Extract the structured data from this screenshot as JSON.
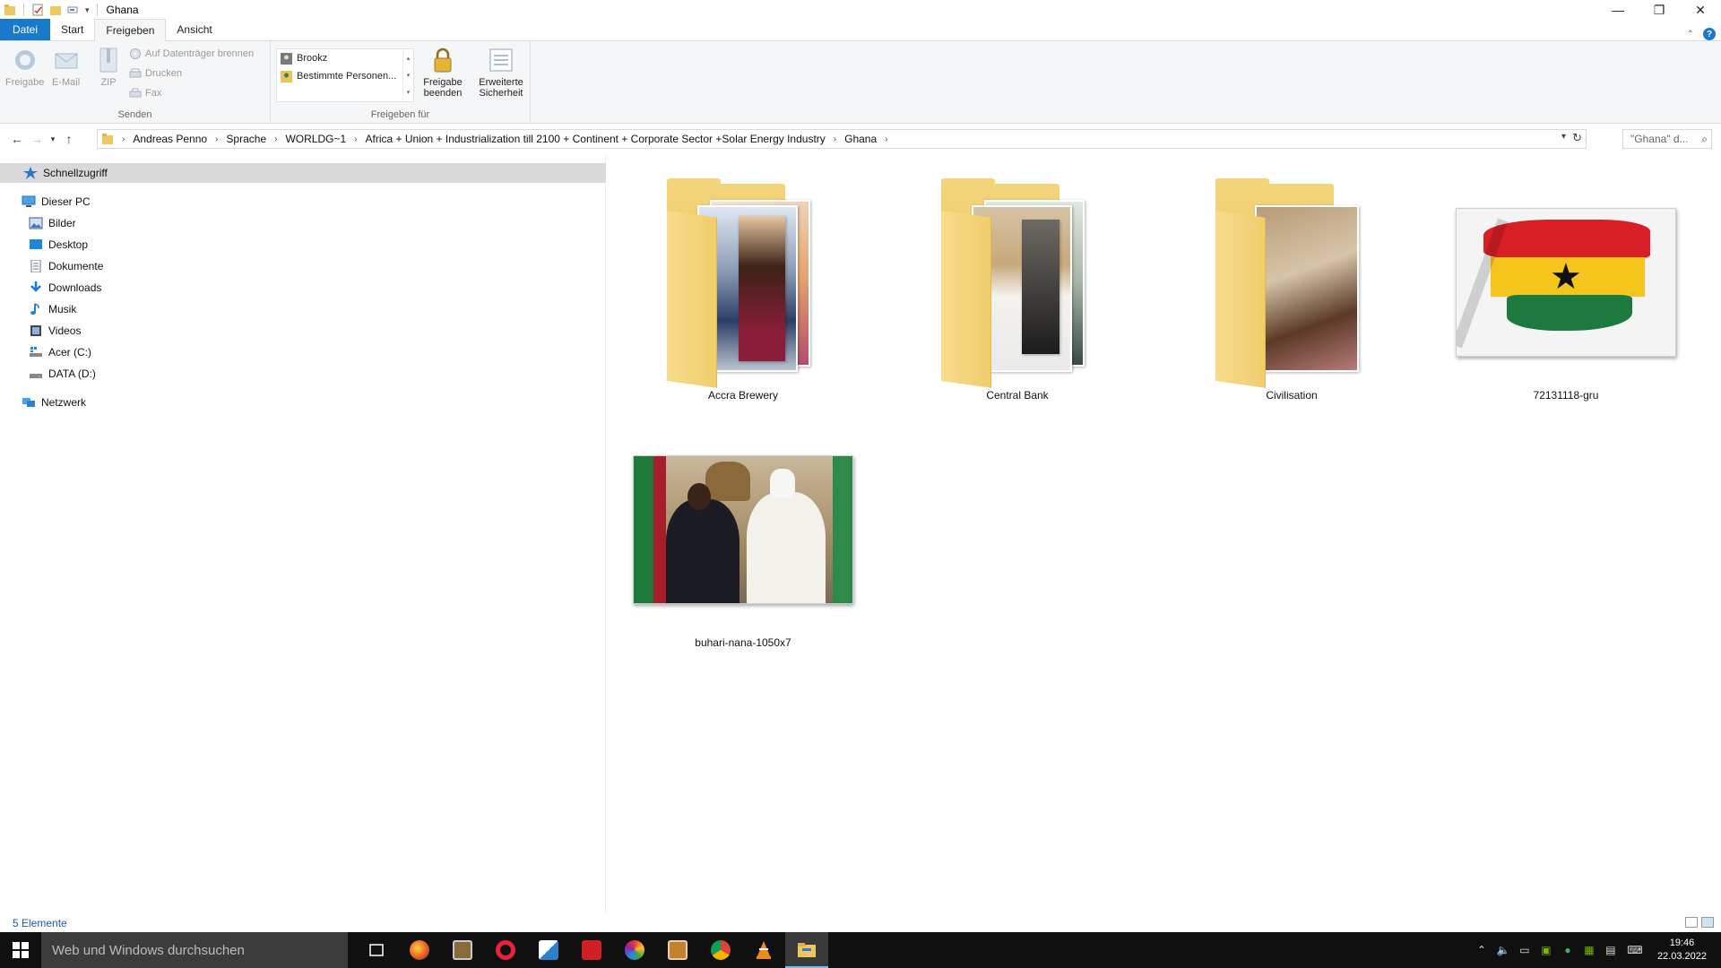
{
  "window": {
    "title": "Ghana",
    "minimize": "—",
    "restore": "❐",
    "close": "✕"
  },
  "ribbon_tabs": [
    "Datei",
    "Start",
    "Freigeben",
    "Ansicht"
  ],
  "ribbon": {
    "send_group": {
      "label": "Senden",
      "share": "Freigabe",
      "email": "E-Mail",
      "zip": "ZIP",
      "burn": "Auf Datenträger brennen",
      "print": "Drucken",
      "fax": "Fax"
    },
    "share_group": {
      "label": "Freigeben für",
      "items": [
        "Brookz",
        "Bestimmte Personen..."
      ],
      "stop_sharing": "Freigabe beenden",
      "advanced_security": "Erweiterte Sicherheit"
    }
  },
  "address": {
    "crumbs": [
      "Andreas Penno",
      "Sprache",
      "WORLDG~1",
      "Africa + Union + Industrialization till 2100 + Continent + Corporate Sector +Solar Energy Industry",
      "Ghana"
    ],
    "search_placeholder": "\"Ghana\" d..."
  },
  "nav": {
    "quick_access": "Schnellzugriff",
    "this_pc": "Dieser PC",
    "items": [
      "Bilder",
      "Desktop",
      "Dokumente",
      "Downloads",
      "Musik",
      "Videos",
      "Acer (C:)",
      "DATA (D:)"
    ],
    "network": "Netzwerk"
  },
  "files": [
    {
      "name": "Accra Brewery",
      "type": "folder"
    },
    {
      "name": "Central Bank",
      "type": "folder"
    },
    {
      "name": "Civilisation",
      "type": "folder"
    },
    {
      "name": "72131118-gru",
      "type": "image"
    },
    {
      "name": "buhari-nana-1050x7",
      "type": "image"
    }
  ],
  "status": {
    "count": "5 Elemente"
  },
  "taskbar": {
    "search_placeholder": "Web und Windows durchsuchen",
    "time": "19:46",
    "date": "22.03.2022"
  }
}
